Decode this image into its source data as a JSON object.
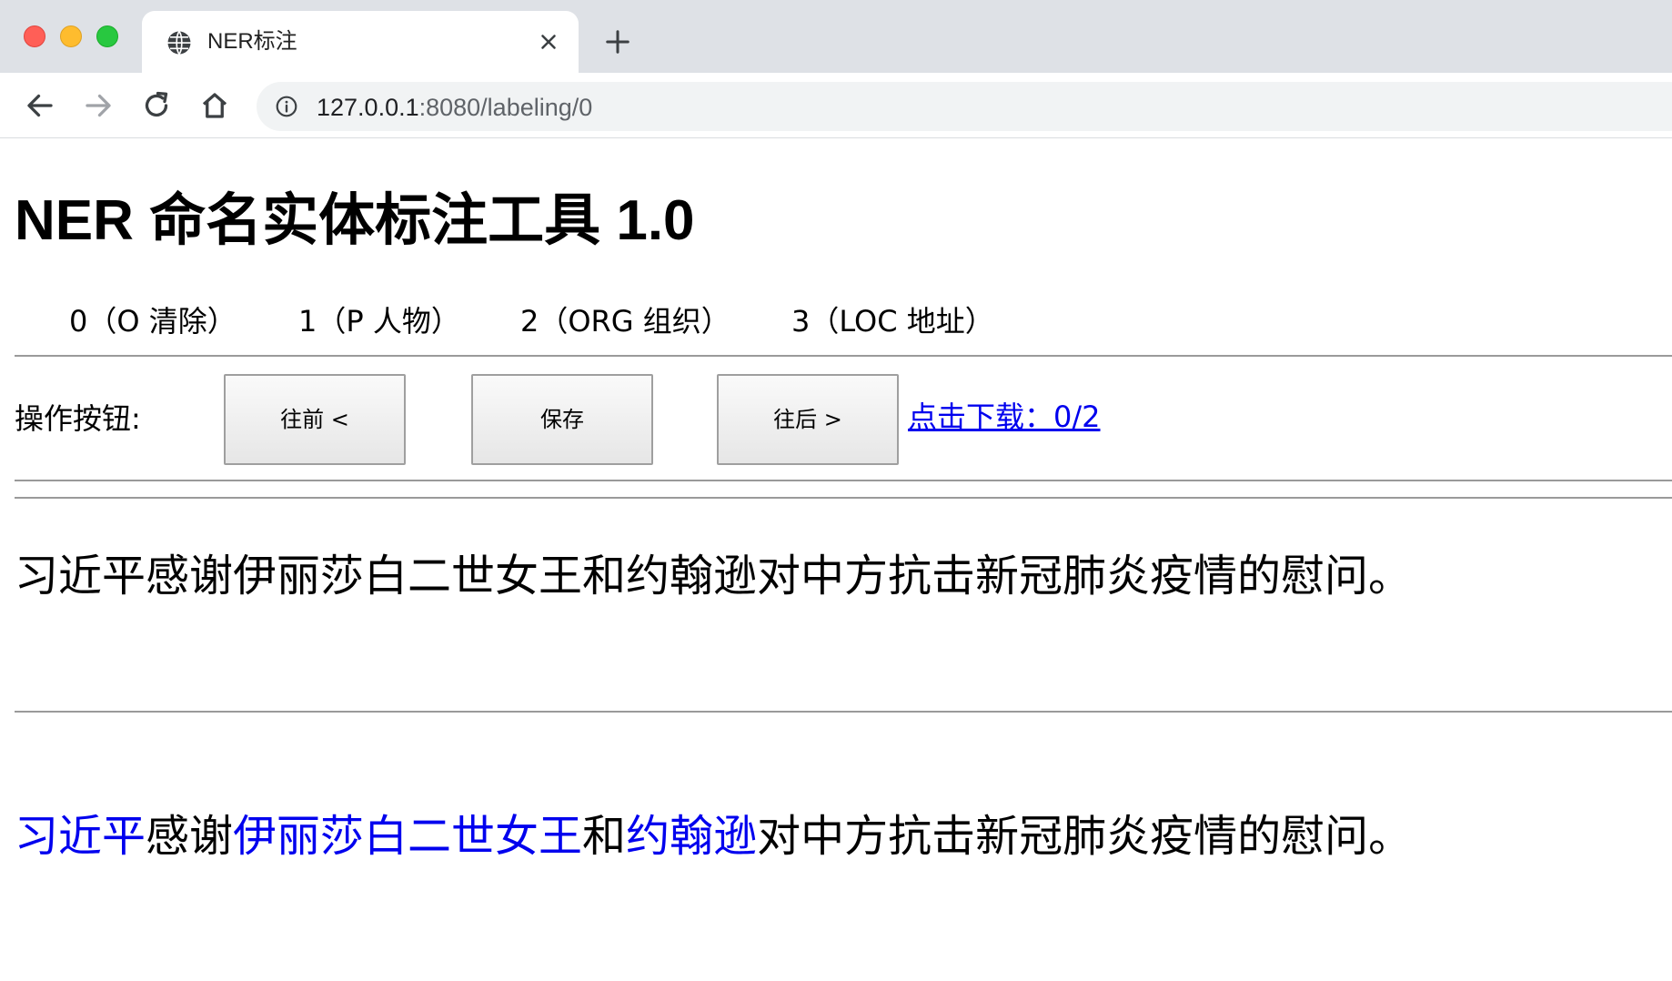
{
  "browser": {
    "tab_title": "NER标注",
    "url_host": "127.0.0.1",
    "url_rest": ":8080/labeling/0",
    "colors": {
      "close": "#ff5f57",
      "minimize": "#febc2e",
      "zoom": "#28c840"
    }
  },
  "page": {
    "title": "NER 命名实体标注工具 1.0",
    "labels": [
      {
        "text": "0（O 清除）"
      },
      {
        "text": "1（P 人物）"
      },
      {
        "text": "2（ORG 组织）"
      },
      {
        "text": "3（LOC 地址）"
      }
    ],
    "ops_label": "操作按钮:",
    "buttons": {
      "prev": "往前 <",
      "save": "保存",
      "next": "往后 >"
    },
    "download_link": "点击下载：0/2",
    "sentence": "习近平感谢伊丽莎白二世女王和约翰逊对中方抗击新冠肺炎疫情的慰问。",
    "tagged_segments": [
      {
        "text": "习近平",
        "entity": true
      },
      {
        "text": "感谢",
        "entity": false
      },
      {
        "text": "伊丽莎白二世女王",
        "entity": true
      },
      {
        "text": "和",
        "entity": false
      },
      {
        "text": "约翰逊",
        "entity": true
      },
      {
        "text": "对中方抗击新冠肺炎疫情的慰问。",
        "entity": false
      }
    ],
    "entity_color": "#0000ee"
  }
}
